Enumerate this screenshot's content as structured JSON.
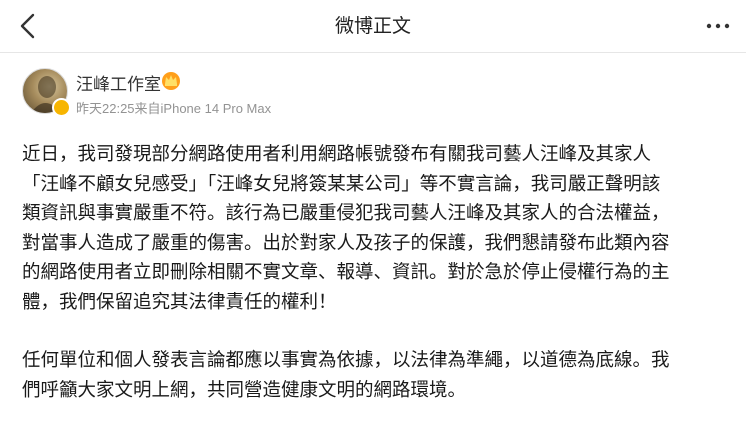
{
  "nav": {
    "title": "微博正文",
    "back_icon": "back-chevron-icon",
    "more_icon": "more-dots-icon"
  },
  "author": {
    "name": "汪峰工作室",
    "meta": "昨天22:25来自iPhone 14 Pro Max",
    "badge_icon": "crown-icon",
    "verified_color": "#f7b500"
  },
  "post": {
    "paragraph1_lines": [
      "近日，我司發現部分網路使用者利用網路帳號發布有關我司藝人汪峰及其家人",
      "「汪峰不顧女兒感受」「汪峰女兒將簽某某公司」等不實言論，我司嚴正聲明該",
      "類資訊與事實嚴重不符。該行為已嚴重侵犯我司藝人汪峰及其家人的合法權益，",
      "對當事人造成了嚴重的傷害。出於對家人及孩子的保護，我們懇請發布此類內容",
      "的網路使用者立即刪除相關不實文章、報導、資訊。對於急於停止侵權行為的主",
      "體，我們保留追究其法律責任的權利！"
    ],
    "paragraph2_lines": [
      "任何單位和個人發表言論都應以事實為依據，以法律為準繩，以道德為底線。我",
      "們呼籲大家文明上網，共同營造健康文明的網路環境。"
    ]
  }
}
